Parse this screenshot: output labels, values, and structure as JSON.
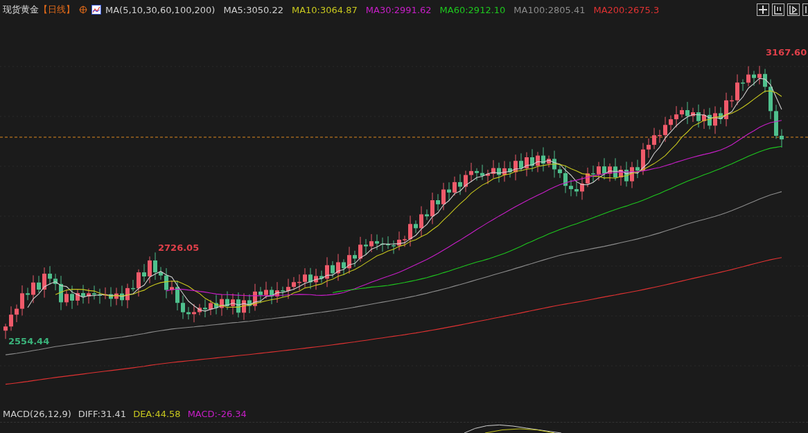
{
  "header": {
    "title": "现货黄金",
    "period": "【日线】",
    "indicator": "MA(5,10,30,60,100,200)",
    "ma_values": [
      {
        "label": "MA5:3050.22",
        "color": "#d0d0d0"
      },
      {
        "label": "MA10:3064.87",
        "color": "#c8c81e"
      },
      {
        "label": "MA30:2991.62",
        "color": "#c81ec8"
      },
      {
        "label": "MA60:2912.10",
        "color": "#1ec81e"
      },
      {
        "label": "MA100:2805.41",
        "color": "#8c8c8c"
      },
      {
        "label": "MA200:2675.3",
        "color": "#e03232"
      }
    ]
  },
  "price_marks": [
    {
      "text": "3167.60",
      "kind": "high"
    },
    {
      "text": "2726.05",
      "kind": "high"
    },
    {
      "text": "2554.44",
      "kind": "low"
    }
  ],
  "macd": {
    "label": "MACD(26,12,9)",
    "values": [
      {
        "label": "DIFF:31.41",
        "color": "#d0d0d0"
      },
      {
        "label": "DEA:44.58",
        "color": "#c8c81e"
      },
      {
        "label": "MACD:-26.34",
        "color": "#c81ec8"
      }
    ]
  }
}
